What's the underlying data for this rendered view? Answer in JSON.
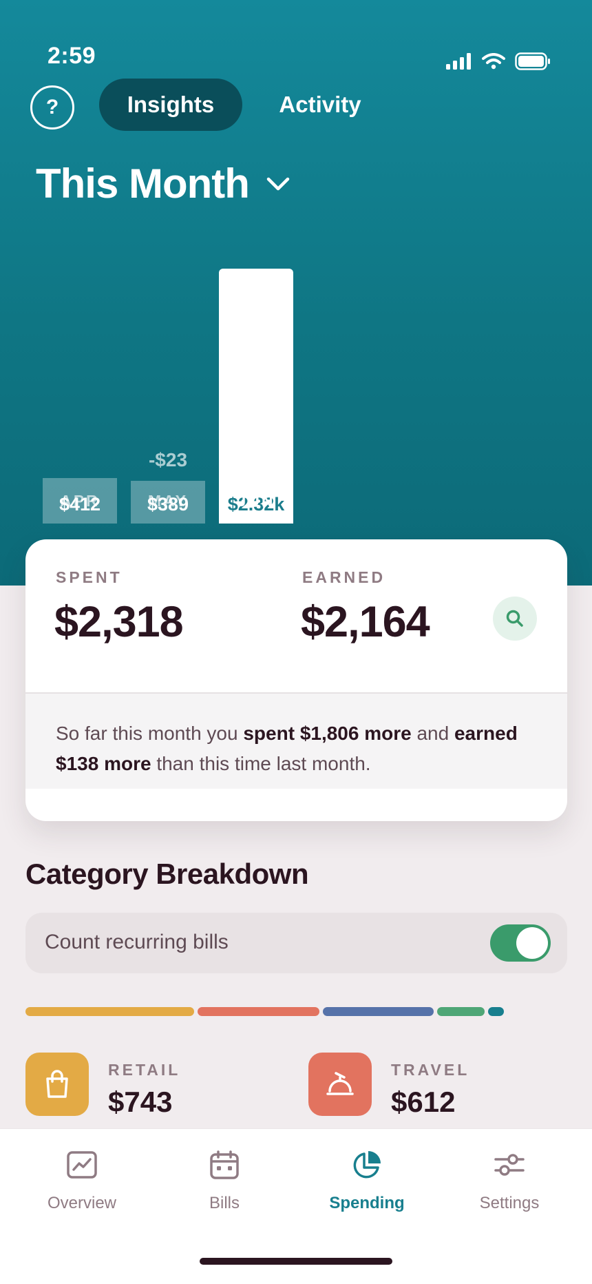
{
  "status": {
    "time": "2:59"
  },
  "header": {
    "help_glyph": "?",
    "tabs": [
      {
        "label": "Insights",
        "active": true
      },
      {
        "label": "Activity",
        "active": false
      }
    ],
    "period": "This Month"
  },
  "chart_data": {
    "type": "bar",
    "categories": [
      "APR",
      "MAY",
      "JUN"
    ],
    "values": [
      412,
      389,
      2318
    ],
    "value_labels": [
      "$412",
      "$389",
      "$2.32k"
    ],
    "annotations": [
      {
        "category": "MAY",
        "text": "-$23"
      }
    ],
    "highlighted": "JUN"
  },
  "summary": {
    "spent_label": "SPENT",
    "spent_value": "$2,318",
    "earned_label": "EARNED",
    "earned_value": "$2,164",
    "text_1": "So far this month you ",
    "text_2": "spent $1,806 more",
    "text_3": " and ",
    "text_4": "earned $138 more",
    "text_5": " than this time last month."
  },
  "breakdown": {
    "title": "Category Breakdown",
    "toggle_label": "Count recurring bills",
    "toggle_on": true,
    "segments": [
      {
        "color": "#e3aa45",
        "share": 0.32
      },
      {
        "color": "#e2735f",
        "share": 0.23
      },
      {
        "color": "#5672a9",
        "share": 0.21
      },
      {
        "color": "#4fa676",
        "share": 0.09
      },
      {
        "color": "#187f8e",
        "share": 0.03
      }
    ],
    "categories": [
      {
        "label": "RETAIL",
        "value": "$743",
        "color": "#e3aa45",
        "icon": "shopping-bag-icon"
      },
      {
        "label": "TRAVEL",
        "value": "$612",
        "color": "#e2735f",
        "icon": "service-bell-icon"
      }
    ]
  },
  "tabbar": {
    "items": [
      {
        "label": "Overview",
        "icon": "chart-line-icon",
        "active": false
      },
      {
        "label": "Bills",
        "icon": "calendar-icon",
        "active": false
      },
      {
        "label": "Spending",
        "icon": "pie-chart-icon",
        "active": true
      },
      {
        "label": "Settings",
        "icon": "sliders-icon",
        "active": false
      }
    ]
  },
  "colors": {
    "accent": "#187f8e",
    "hero": "#117c8a",
    "text": "#2b1520"
  }
}
